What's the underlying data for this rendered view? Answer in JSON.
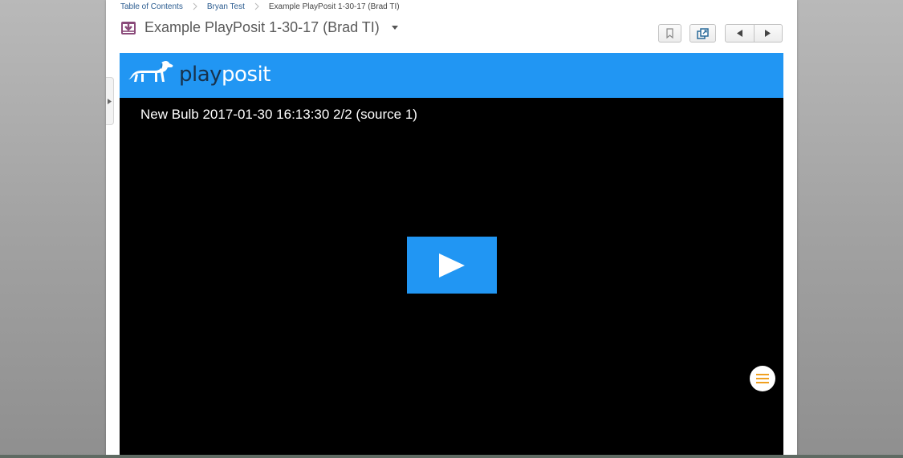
{
  "breadcrumb": {
    "items": [
      "Table of Contents",
      "Bryan Test"
    ],
    "current": "Example PlayPosit 1-30-17 (Brad TI)"
  },
  "header": {
    "title": "Example PlayPosit 1-30-17 (Brad TI)",
    "icon": "download-tray-icon"
  },
  "toolbar": {
    "bookmark_icon": "bookmark-icon",
    "popout_icon": "new-window-icon",
    "prev_icon": "triangle-left-icon",
    "next_icon": "triangle-right-icon"
  },
  "player": {
    "brand_play": "play",
    "brand_posit": "posit",
    "video_title": "New Bulb 2017-01-30 16:13:30 2/2 (source 1)",
    "play_icon": "play-icon",
    "menu_icon": "hamburger-menu-icon"
  },
  "colors": {
    "brand_blue": "#2196f3",
    "video_bg": "#000000",
    "menu_accent": "#f0a020",
    "doc_icon": "#8a4a7a"
  }
}
